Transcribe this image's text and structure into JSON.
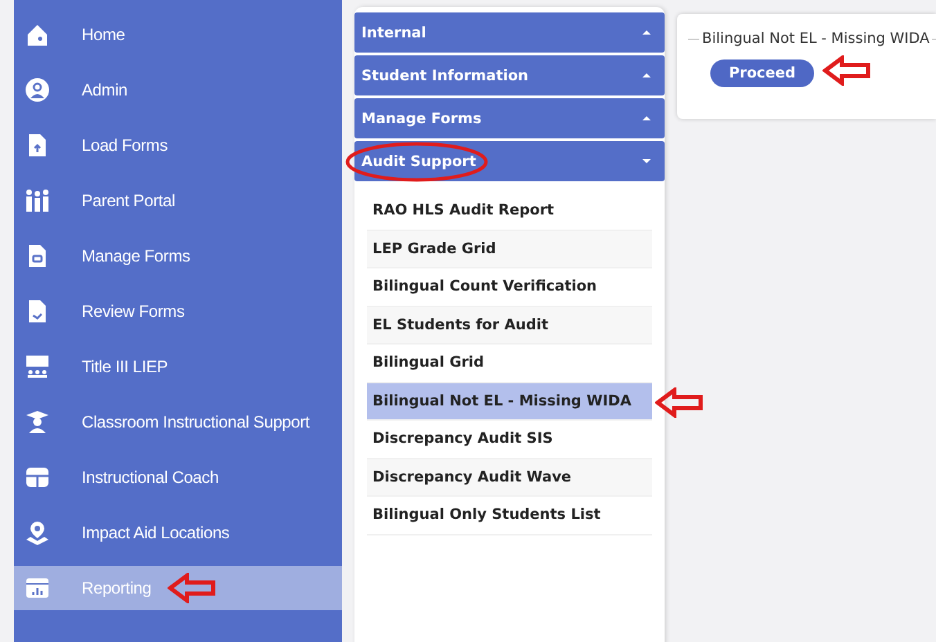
{
  "sidebar": {
    "items": [
      {
        "label": "Home",
        "selected": false,
        "annotated": false
      },
      {
        "label": "Admin",
        "selected": false,
        "annotated": false
      },
      {
        "label": "Load Forms",
        "selected": false,
        "annotated": false
      },
      {
        "label": "Parent Portal",
        "selected": false,
        "annotated": false
      },
      {
        "label": "Manage Forms",
        "selected": false,
        "annotated": false
      },
      {
        "label": "Review Forms",
        "selected": false,
        "annotated": false
      },
      {
        "label": "Title III LIEP",
        "selected": false,
        "annotated": false
      },
      {
        "label": "Classroom Instructional Support",
        "selected": false,
        "annotated": false
      },
      {
        "label": "Instructional Coach",
        "selected": false,
        "annotated": false
      },
      {
        "label": "Impact Aid Locations",
        "selected": false,
        "annotated": false
      },
      {
        "label": "Reporting",
        "selected": true,
        "annotated": true
      }
    ]
  },
  "forms_panel": {
    "sections": [
      {
        "title": "Internal",
        "expanded": false,
        "circled": false
      },
      {
        "title": "Student Information",
        "expanded": false,
        "circled": false
      },
      {
        "title": "Manage Forms",
        "expanded": false,
        "circled": false
      },
      {
        "title": "Audit Support",
        "expanded": true,
        "circled": true,
        "items": [
          {
            "label": "RAO HLS Audit Report",
            "selected": false,
            "annotated": false
          },
          {
            "label": "LEP Grade Grid",
            "selected": false,
            "annotated": false
          },
          {
            "label": "Bilingual Count Verification",
            "selected": false,
            "annotated": false
          },
          {
            "label": "EL Students for Audit",
            "selected": false,
            "annotated": false
          },
          {
            "label": "Bilingual Grid",
            "selected": false,
            "annotated": false
          },
          {
            "label": "Bilingual Not EL - Missing WIDA",
            "selected": true,
            "annotated": true
          },
          {
            "label": "Discrepancy Audit SIS",
            "selected": false,
            "annotated": false
          },
          {
            "label": "Discrepancy Audit Wave",
            "selected": false,
            "annotated": false
          },
          {
            "label": "Bilingual Only Students List",
            "selected": false,
            "annotated": false
          }
        ]
      }
    ]
  },
  "report": {
    "title": "Bilingual Not EL - Missing WIDA",
    "button": {
      "label": "Proceed",
      "annotated": true
    }
  }
}
